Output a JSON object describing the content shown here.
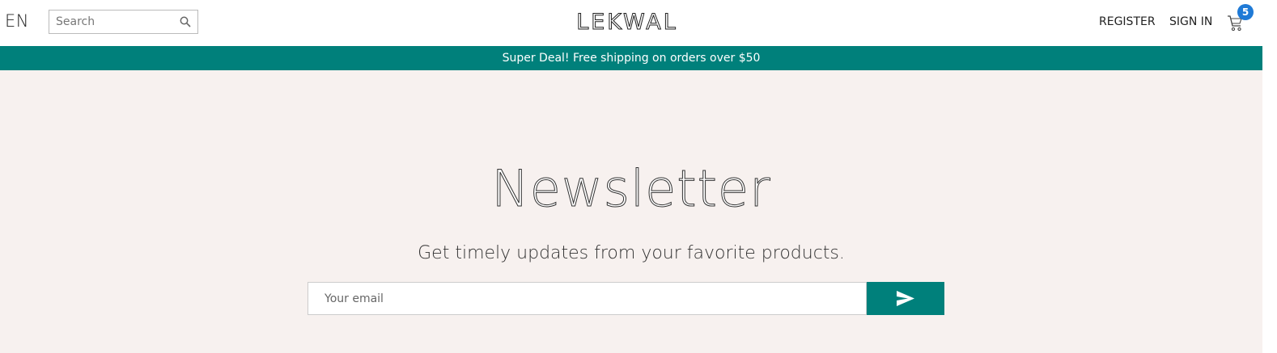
{
  "header": {
    "language": "EN",
    "search": {
      "placeholder": "Search",
      "value": ""
    },
    "logo": "LEKWAL",
    "register_label": "REGISTER",
    "signin_label": "SIGN IN",
    "cart_count": "5"
  },
  "promo": {
    "text": "Super Deal! Free shipping on orders over $50"
  },
  "newsletter": {
    "title": "Newsletter",
    "subtitle": "Get timely updates from your favorite products.",
    "email_placeholder": "Your email"
  },
  "colors": {
    "accent": "#00807b",
    "badge": "#1f7ad6",
    "section_bg": "#f7f1ef"
  },
  "icons": [
    "search-icon",
    "cart-icon",
    "send-icon"
  ]
}
